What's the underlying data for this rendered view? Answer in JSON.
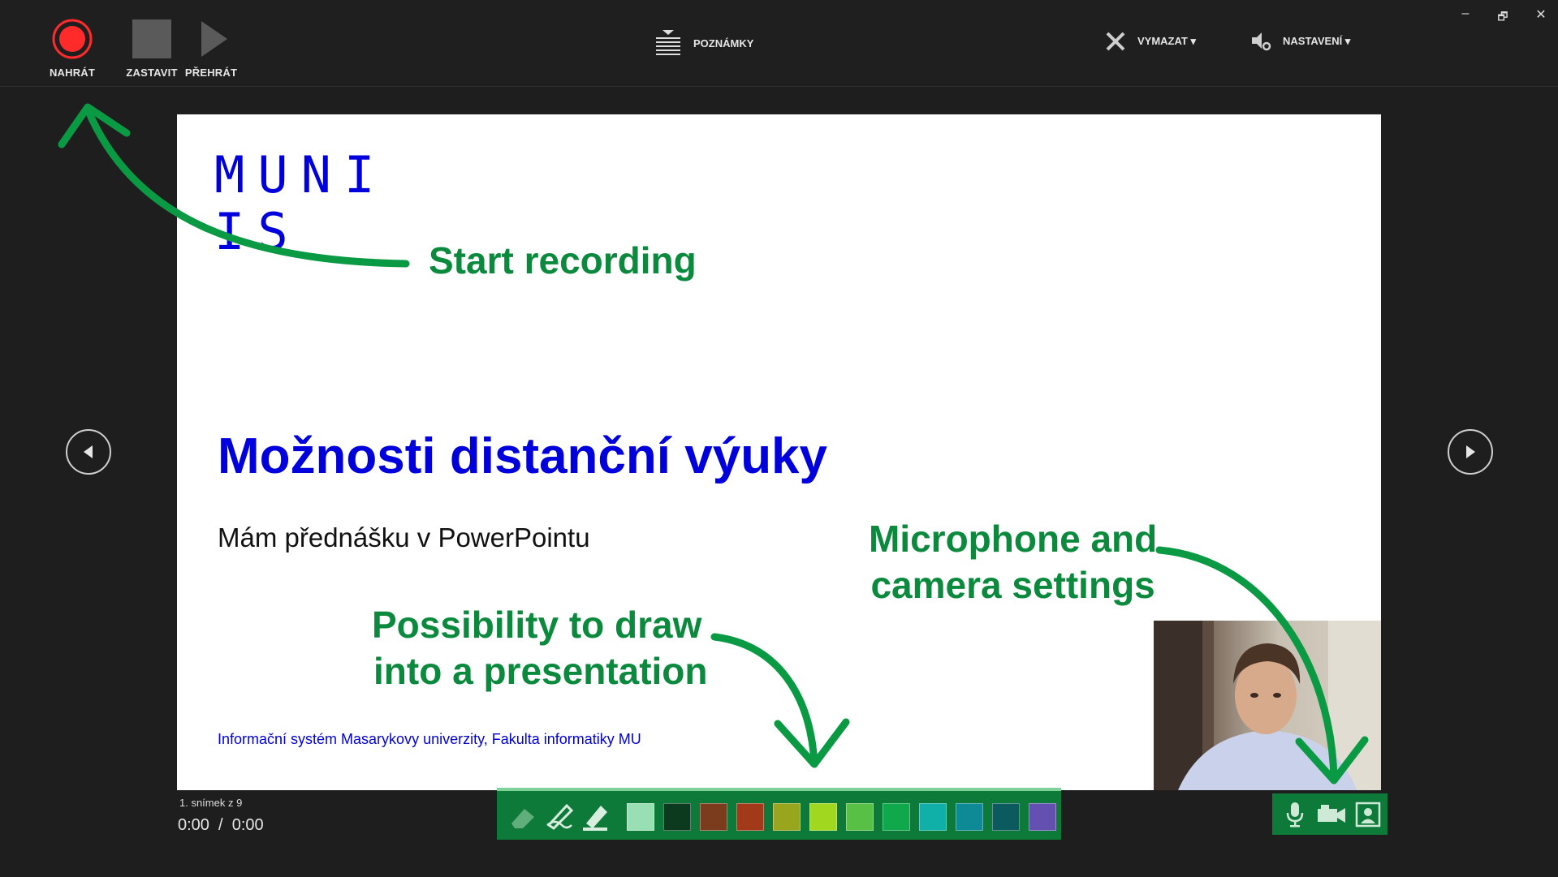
{
  "toolbar": {
    "record_label": "NAHRÁT",
    "stop_label": "ZASTAVIT",
    "play_label": "PŘEHRÁT",
    "notes_label": "POZNÁMKY",
    "clear_label": "VYMAZAT ▾",
    "settings_label": "NASTAVENÍ ▾",
    "record_color": "#ff2b2b"
  },
  "window_controls": {
    "minimize": "–",
    "restore": "🗗",
    "close": "✕"
  },
  "slide": {
    "logo_line1": "MUNI",
    "logo_line2": "IS",
    "title": "Možnosti distanční výuky",
    "subtitle": "Mám přednášku v PowerPointu",
    "footer": "Informační systém Masarykovy univerzity, Fakulta informatiky MU",
    "accent_color": "#0000dc"
  },
  "status": {
    "slide_counter": "1. snímek z 9",
    "time": "0:00  /  0:00"
  },
  "ink_tools": {
    "tools": [
      "eraser-icon",
      "pen-icon",
      "highlighter-icon"
    ],
    "colors": [
      "#98e0b4",
      "#0b3a1e",
      "#7a3c1c",
      "#a23a1a",
      "#9aa51e",
      "#9fd81e",
      "#58c045",
      "#0fa84a",
      "#10b0a8",
      "#0d8a96",
      "#0b5a5e",
      "#6450b0"
    ]
  },
  "recording_controls": [
    "microphone-icon",
    "camera-icon",
    "camera-preview-icon"
  ],
  "annotations": {
    "start_recording": "Start recording",
    "draw_line1": "Possibility to draw",
    "draw_line2": "into a presentation",
    "mic_line1": "Microphone and",
    "mic_line2": "camera settings",
    "color": "#0b8a3e"
  }
}
